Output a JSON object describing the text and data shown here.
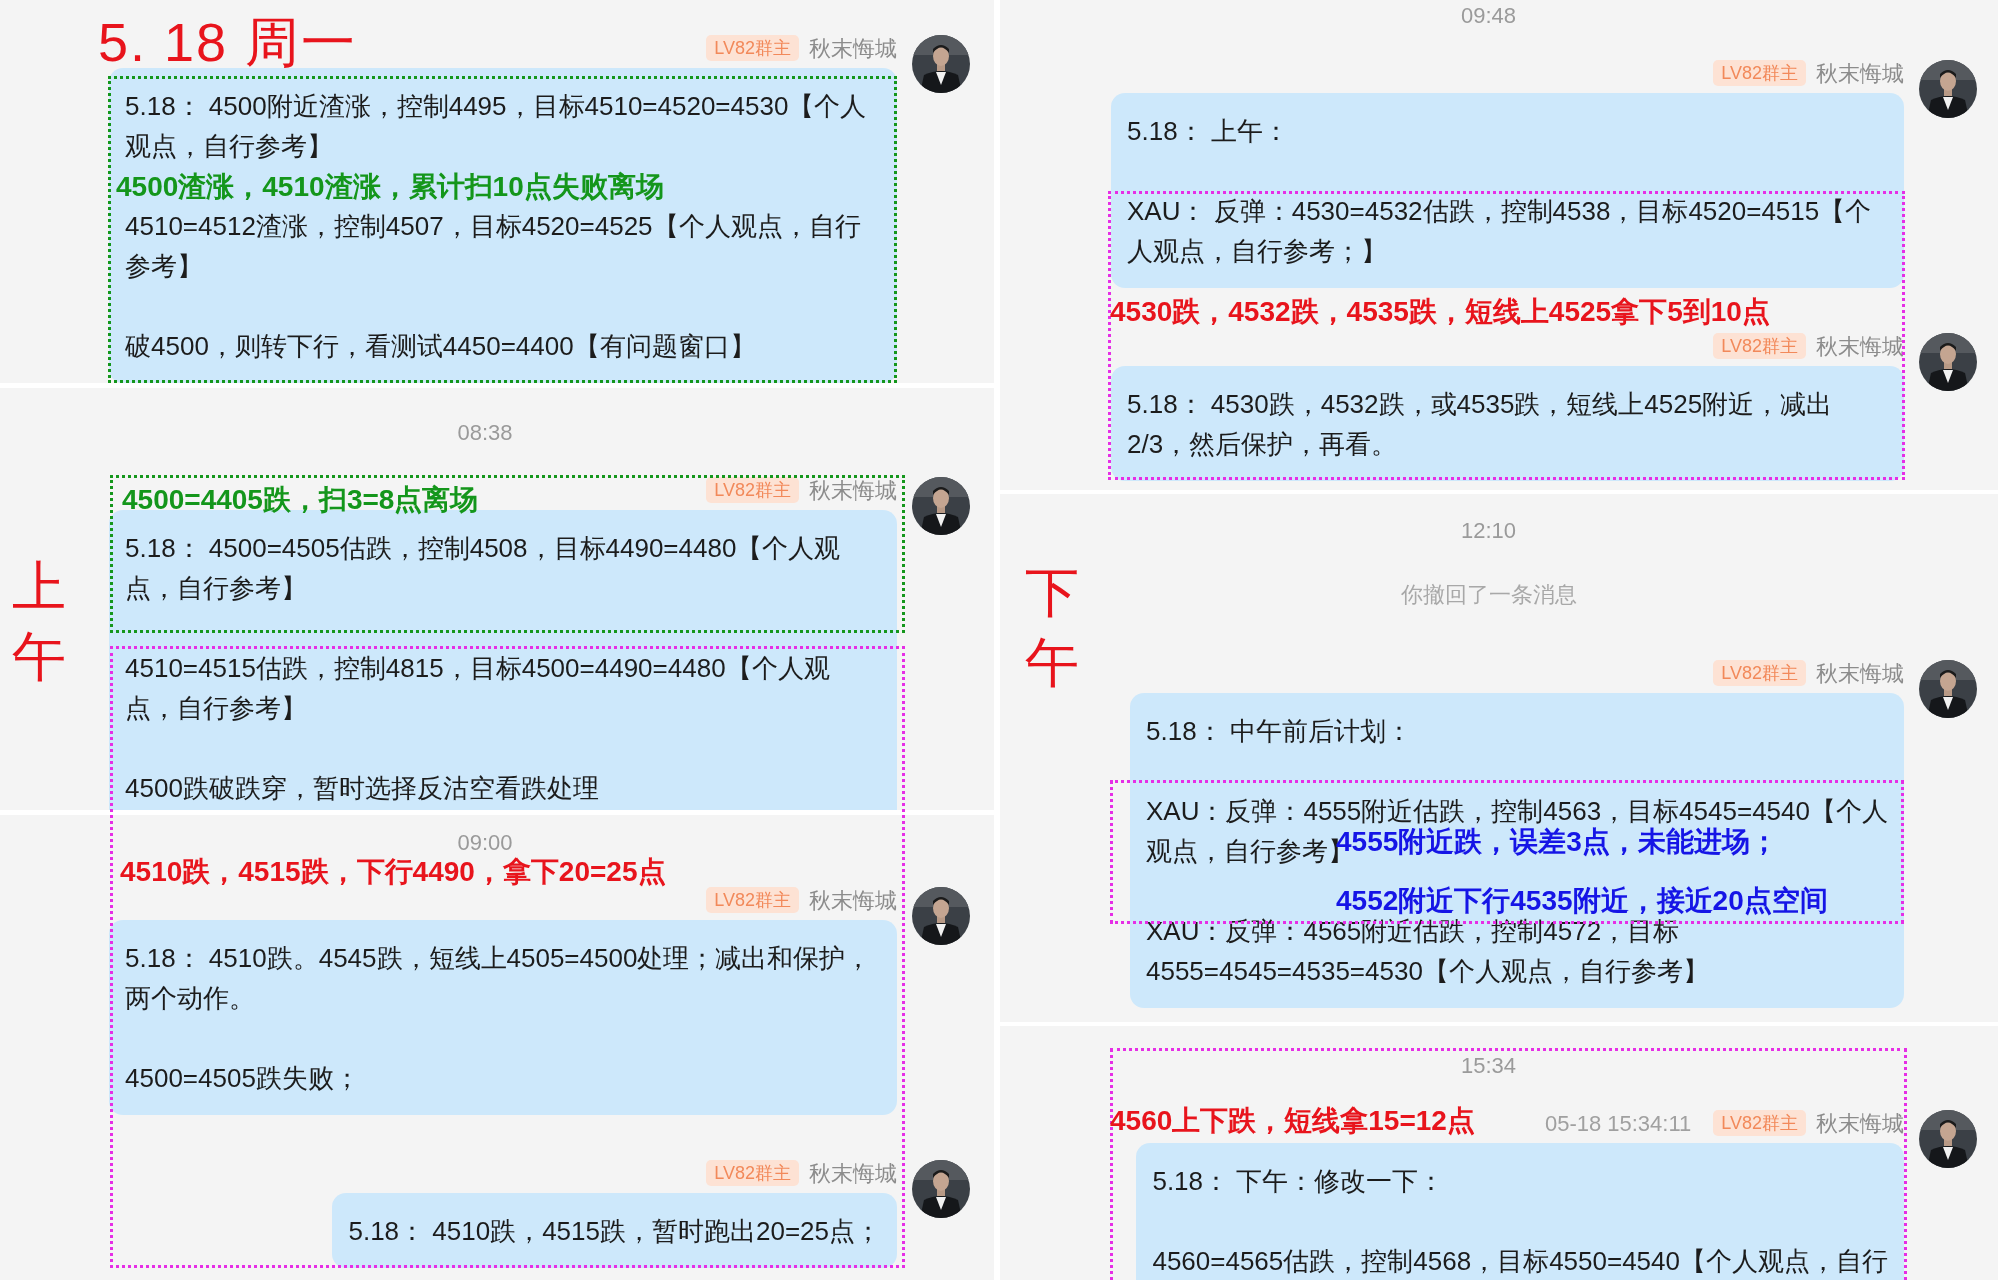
{
  "annotations": [
    {
      "kind": "title",
      "text": "5. 18 周一",
      "color": "#e8141c"
    },
    {
      "kind": "note",
      "text": "4500渣涨，4510渣涨，累计扫10点失败离场",
      "color": "#14961b"
    },
    {
      "kind": "note",
      "text": "4500=4405跌，扫3=8点离场",
      "color": "#14961b"
    },
    {
      "kind": "note",
      "text": "4510跌，4515跌，下行4490，拿下20=25点",
      "color": "#e8141c"
    },
    {
      "kind": "session",
      "text": "上午",
      "color": "#e8141c"
    },
    {
      "kind": "note",
      "text": "4530跌，4532跌，4535跌，短线上4525拿下5到10点",
      "color": "#e8141c"
    },
    {
      "kind": "session",
      "text": "下午",
      "color": "#e8141c"
    },
    {
      "kind": "note",
      "text": "4555附近跌，误差3点，未能进场；",
      "color": "#1515e6"
    },
    {
      "kind": "note",
      "text": "4552附近下行4535附近，接近20点空间",
      "color": "#1515e6"
    },
    {
      "kind": "note",
      "text": "4560上下跌，短线拿15=12点",
      "color": "#e8141c"
    }
  ],
  "frames": [
    {
      "color": "#14961b"
    },
    {
      "color": "#14961b"
    },
    {
      "color": "#e62ee6"
    },
    {
      "color": "#e62ee6"
    },
    {
      "color": "#e62ee6"
    },
    {
      "color": "#e62ee6"
    }
  ],
  "columns": [
    {
      "panels": [
        {
          "items": [
            {
              "kind": "message",
              "badge": "LV82群主",
              "sender": "秋末悔城",
              "paragraphs": [
                "5.18： 4500附近渣涨，控制4495，目标4510=4520=4530【个人观点，自行参考】",
                "4510=4512渣涨，控制4507，目标4520=4525【个人观点，自行参考】",
                "破4500，则转下行，看测试4450=4400【有问题窗口】"
              ]
            }
          ]
        },
        {
          "items": [
            {
              "kind": "time",
              "text": "08:38"
            },
            {
              "kind": "message",
              "badge": "LV82群主",
              "sender": "秋末悔城",
              "paragraphs": [
                "5.18： 4500=4505估跌，控制4508，目标4490=4480【个人观点，自行参考】",
                "4510=4515估跌，控制4815，目标4500=4490=4480【个人观点，自行参考】",
                "4500跌破跌穿，暂时选择反沽空看跌处理"
              ]
            }
          ]
        },
        {
          "items": [
            {
              "kind": "time",
              "text": "09:00"
            },
            {
              "kind": "message",
              "badge": "LV82群主",
              "sender": "秋末悔城",
              "paragraphs": [
                "5.18： 4510跌。4545跌，短线上4505=4500处理；减出和保护，两个动作。",
                "4500=4505跌失败；"
              ]
            },
            {
              "kind": "message",
              "badge": "LV82群主",
              "sender": "秋末悔城",
              "paragraphs": [
                "5.18： 4510跌，4515跌，暂时跑出20=25点；"
              ]
            }
          ]
        }
      ]
    },
    {
      "panels": [
        {
          "items": [
            {
              "kind": "time",
              "text": "09:48"
            },
            {
              "kind": "message",
              "badge": "LV82群主",
              "sender": "秋末悔城",
              "paragraphs": [
                "5.18： 上午：",
                "XAU： 反弹：4530=4532估跌，控制4538，目标4520=4515【个人观点，自行参考；】"
              ]
            },
            {
              "kind": "message",
              "badge": "LV82群主",
              "sender": "秋末悔城",
              "paragraphs": [
                "5.18： 4530跌，4532跌，或4535跌，短线上4525附近，减出2/3，然后保护，再看。"
              ]
            }
          ]
        },
        {
          "items": [
            {
              "kind": "time",
              "text": "12:10"
            },
            {
              "kind": "notice",
              "text": "你撤回了一条消息"
            },
            {
              "kind": "message",
              "badge": "LV82群主",
              "sender": "秋末悔城",
              "paragraphs": [
                "5.18： 中午前后计划：",
                [
                  "XAU：反弹：4555附近估跌，控制4563，目标4545=4540【个人",
                  "观点，自行参考】"
                ],
                [
                  "XAU：反弹：4565附近估跌，控制4572，目标",
                  "4555=4545=4535=4530【个人观点，自行参考】"
                ]
              ]
            }
          ]
        },
        {
          "items": [
            {
              "kind": "time",
              "text": "15:34"
            },
            {
              "kind": "message",
              "timestamp": "05-18 15:34:11",
              "badge": "LV82群主",
              "sender": "秋末悔城",
              "paragraphs": [
                "5.18： 下午：修改一下：",
                "4560=4565估跌，控制4568，目标4550=4540【个人观点，自行"
              ]
            }
          ]
        }
      ]
    }
  ]
}
